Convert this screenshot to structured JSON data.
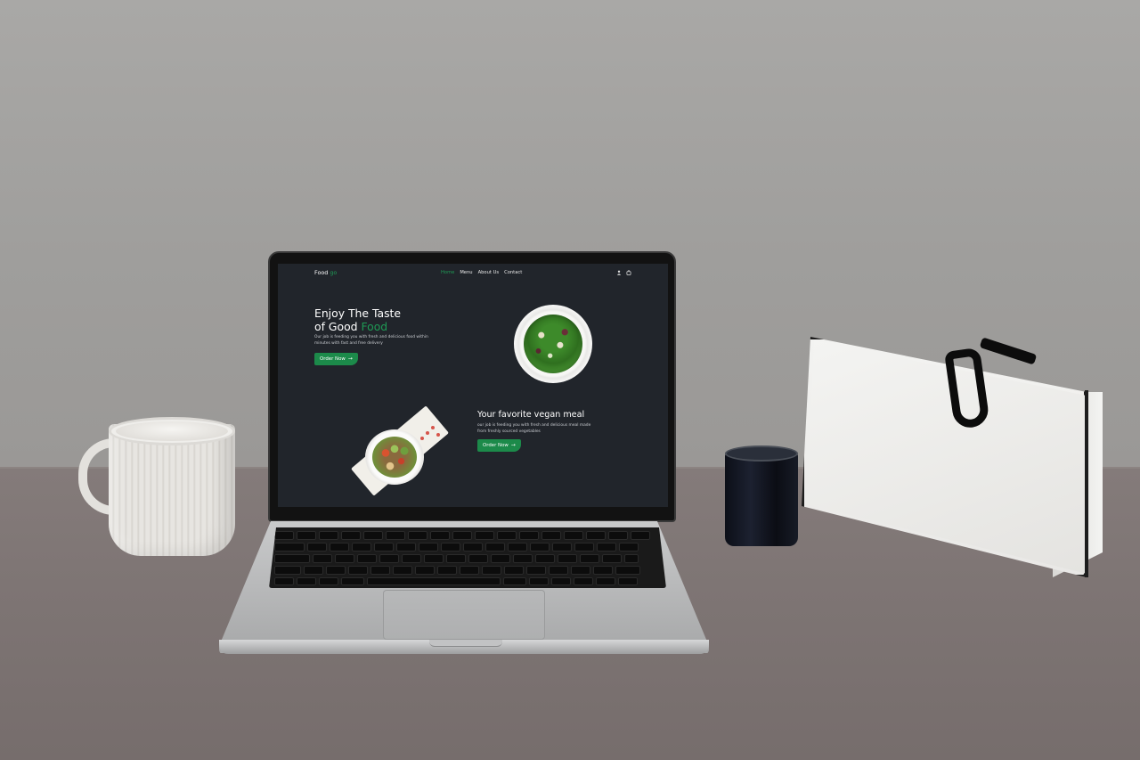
{
  "site": {
    "logo": {
      "text": "Food",
      "accent": "go"
    },
    "nav": {
      "links": [
        {
          "label": "Home",
          "active": true
        },
        {
          "label": "Menu",
          "active": false
        },
        {
          "label": "About Us",
          "active": false
        },
        {
          "label": "Contact",
          "active": false
        }
      ],
      "icons": [
        "user-icon",
        "cart-icon"
      ]
    },
    "hero": {
      "title_line1": "Enjoy The Taste",
      "title_line2_prefix": "of Good ",
      "title_line2_accent": "Food",
      "subtitle": "Our job is feeding you with fresh and delicious food within minutes with fast and free delivery",
      "cta_label": "Order Now",
      "cta_icon": "arrow-right-icon"
    },
    "feature": {
      "title": "Your favorite vegan meal",
      "subtitle": "our job is feeding you with fresh and delicious meal made from freshly sourced vegetables",
      "cta_label": "Order Now",
      "cta_icon": "arrow-right-icon"
    }
  },
  "colors": {
    "accent": "#1f9a55",
    "button": "#1c8a4a",
    "screen_bg": "#21252b",
    "text": "#ffffff"
  }
}
